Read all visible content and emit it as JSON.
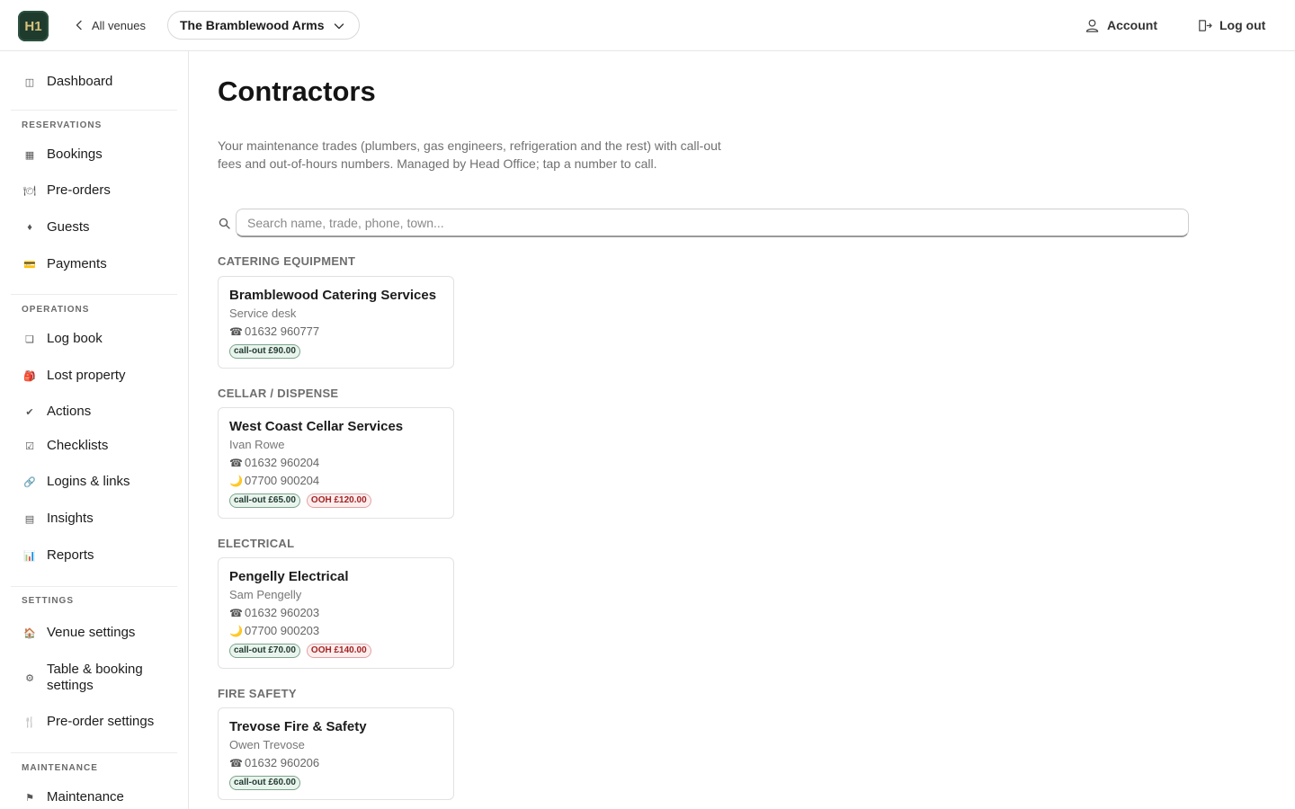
{
  "topbar": {
    "logo_text": "H1",
    "back_label": "All venues",
    "venue_name": "The Bramblewood Arms",
    "account_label": "Account",
    "logout_label": "Log out"
  },
  "sidebar": {
    "dashboard": "Dashboard",
    "sections": {
      "reservations": "RESERVATIONS",
      "operations": "OPERATIONS",
      "settings": "SETTINGS",
      "maintenance": "MAINTENANCE"
    },
    "items": {
      "bookings": "Bookings",
      "preorders": "Pre-orders",
      "guests": "Guests",
      "payments": "Payments",
      "logbook": "Log book",
      "lost_property": "Lost property",
      "actions": "Actions",
      "checklists": "Checklists",
      "logins": "Logins & links",
      "insights": "Insights",
      "reports": "Reports",
      "venue_settings": "Venue settings",
      "table_booking_settings": "Table & booking settings",
      "preorder_settings": "Pre-order settings",
      "maintenance": "Maintenance"
    }
  },
  "main": {
    "title": "Contractors",
    "intro": "Your maintenance trades (plumbers, gas engineers, refrigeration and the rest) with call-out fees and out-of-hours numbers. Managed by Head Office; tap a number to call.",
    "search_placeholder": "Search name, trade, phone, town...",
    "groups": [
      {
        "title": "CATERING EQUIPMENT",
        "contractor": {
          "name": "Bramblewood Catering Services",
          "contact": "Service desk",
          "phone": "01632 960777",
          "callout": "call-out £90.00"
        }
      },
      {
        "title": "CELLAR / DISPENSE",
        "contractor": {
          "name": "West Coast Cellar Services",
          "contact": "Ivan Rowe",
          "phone": "01632 960204",
          "ooh_phone": "07700 900204",
          "callout": "call-out £65.00",
          "ooh_fee": "OOH £120.00"
        }
      },
      {
        "title": "ELECTRICAL",
        "contractor": {
          "name": "Pengelly Electrical",
          "contact": "Sam Pengelly",
          "phone": "01632 960203",
          "ooh_phone": "07700 900203",
          "callout": "call-out £70.00",
          "ooh_fee": "OOH £140.00"
        }
      },
      {
        "title": "FIRE SAFETY",
        "contractor": {
          "name": "Trevose Fire & Safety",
          "contact": "Owen Trevose",
          "phone": "01632 960206",
          "callout": "call-out £60.00"
        }
      }
    ]
  },
  "icons": {
    "phone": "☎",
    "out_of_hours": "🌙"
  },
  "colors": {
    "brand": "#1f3b2e",
    "pill_green_border": "#7aa58b",
    "pill_red_text": "#a32222"
  }
}
